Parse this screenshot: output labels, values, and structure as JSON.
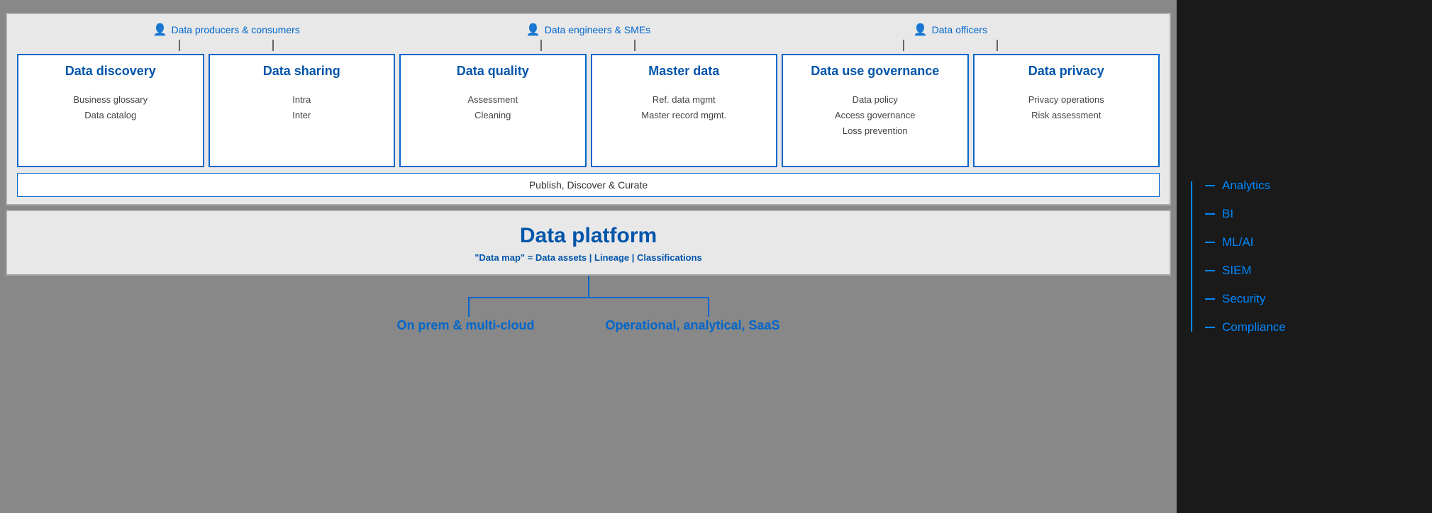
{
  "personas": [
    {
      "label": "Data producers & consumers",
      "icon": "👤"
    },
    {
      "label": "Data engineers & SMEs",
      "icon": "👤"
    },
    {
      "label": "Data officers",
      "icon": "👤"
    }
  ],
  "cards": [
    {
      "title": "Data discovery",
      "items": [
        "Business glossary",
        "Data catalog"
      ]
    },
    {
      "title": "Data sharing",
      "items": [
        "Intra",
        "Inter"
      ]
    },
    {
      "title": "Data quality",
      "items": [
        "Assessment",
        "Cleaning"
      ]
    },
    {
      "title": "Master data",
      "items": [
        "Ref. data mgmt",
        "Master record mgmt."
      ]
    },
    {
      "title": "Data use governance",
      "items": [
        "Data policy",
        "Access governance",
        "Loss prevention"
      ]
    },
    {
      "title": "Data privacy",
      "items": [
        "Privacy operations",
        "Risk assessment"
      ]
    }
  ],
  "publish_bar": "Publish, Discover & Curate",
  "platform": {
    "title": "Data platform",
    "subtitle": "\"Data map\" = Data assets | Lineage | Classifications"
  },
  "bottom_nodes": [
    {
      "label": "On prem & multi-cloud"
    },
    {
      "label": "Operational, analytical, SaaS"
    }
  ],
  "sidebar_items": [
    {
      "label": "Analytics"
    },
    {
      "label": "BI"
    },
    {
      "label": "ML/AI"
    },
    {
      "label": "SIEM"
    },
    {
      "label": "Security"
    },
    {
      "label": "Compliance"
    }
  ]
}
